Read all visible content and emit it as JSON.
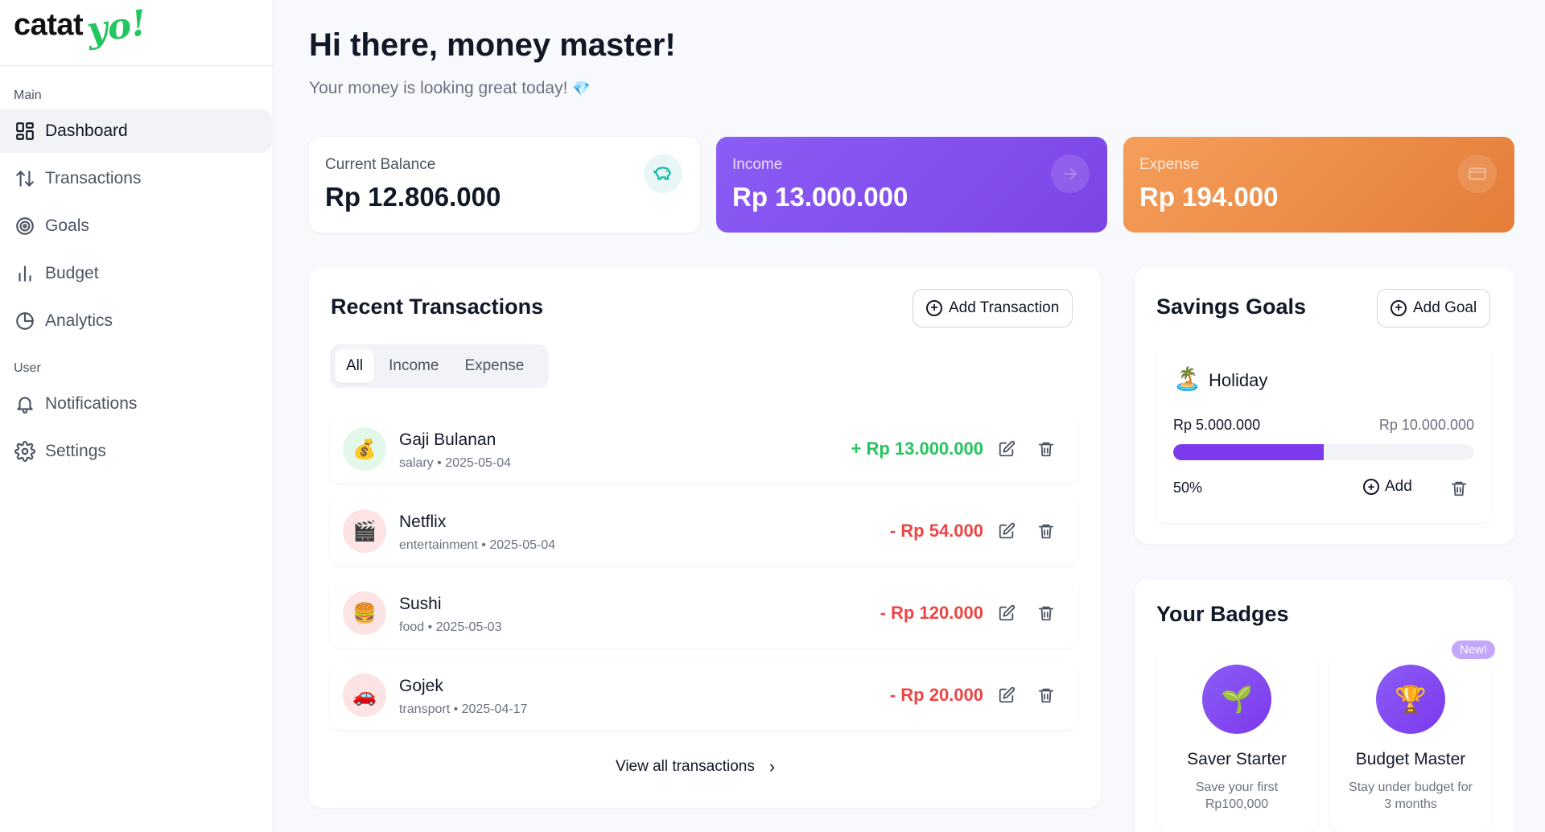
{
  "app": {
    "logo_text": "catat",
    "logo_accent": "yo!"
  },
  "sidebar": {
    "section_main": "Main",
    "section_user": "User",
    "items": [
      {
        "label": "Dashboard",
        "icon": "dashboard-grid-icon",
        "active": true
      },
      {
        "label": "Transactions",
        "icon": "arrows-updown-icon",
        "active": false
      },
      {
        "label": "Goals",
        "icon": "target-icon",
        "active": false
      },
      {
        "label": "Budget",
        "icon": "bar-chart-icon",
        "active": false
      },
      {
        "label": "Analytics",
        "icon": "pie-chart-icon",
        "active": false
      },
      {
        "label": "Notifications",
        "icon": "bell-icon",
        "active": false
      },
      {
        "label": "Settings",
        "icon": "gear-icon",
        "active": false
      }
    ]
  },
  "header": {
    "title": "Hi there, money master!",
    "subtitle": "Your money is looking great today!",
    "subtitle_emoji": "💎"
  },
  "stats": {
    "balance": {
      "label": "Current Balance",
      "value": "Rp 12.806.000",
      "icon": "piggy-bank-icon"
    },
    "income": {
      "label": "Income",
      "value": "Rp 13.000.000",
      "icon": "arrow-icon"
    },
    "expense": {
      "label": "Expense",
      "value": "Rp 194.000",
      "icon": "credit-card-icon"
    }
  },
  "transactions": {
    "title": "Recent Transactions",
    "add_label": "Add Transaction",
    "tabs": [
      "All",
      "Income",
      "Expense"
    ],
    "active_tab": "All",
    "items": [
      {
        "emoji": "💰",
        "name": "Gaji Bulanan",
        "meta": "salary • 2025-05-04",
        "amount": "+ Rp 13.000.000",
        "type": "income",
        "bg": "#e3f8ea"
      },
      {
        "emoji": "🎬",
        "name": "Netflix",
        "meta": "entertainment • 2025-05-04",
        "amount": "- Rp 54.000",
        "type": "expense",
        "bg": "#fde4e4"
      },
      {
        "emoji": "🍔",
        "name": "Sushi",
        "meta": "food • 2025-05-03",
        "amount": "- Rp 120.000",
        "type": "expense",
        "bg": "#fde4e4"
      },
      {
        "emoji": "🚗",
        "name": "Gojek",
        "meta": "transport • 2025-04-17",
        "amount": "- Rp 20.000",
        "type": "expense",
        "bg": "#fde4e4"
      }
    ],
    "view_all": "View all transactions"
  },
  "goals": {
    "title": "Savings Goals",
    "add_label": "Add Goal",
    "items": [
      {
        "emoji": "🏝️",
        "name": "Holiday",
        "current": "Rp 5.000.000",
        "target": "Rp 10.000.000",
        "percent_label": "50%",
        "progress": 0.5,
        "add_label": "Add"
      }
    ]
  },
  "badges": {
    "title": "Your Badges",
    "new_label": "New!",
    "items": [
      {
        "emoji": "🌱",
        "name": "Saver Starter",
        "desc": "Save your first Rp100,000"
      },
      {
        "emoji": "🏆",
        "name": "Budget Master",
        "desc": "Stay under budget for 3 months"
      }
    ]
  },
  "colors": {
    "accent_purple": "#7c3aed",
    "income_green": "#22c55e",
    "expense_red": "#ef4444",
    "expense_orange": "#f59e5b"
  }
}
